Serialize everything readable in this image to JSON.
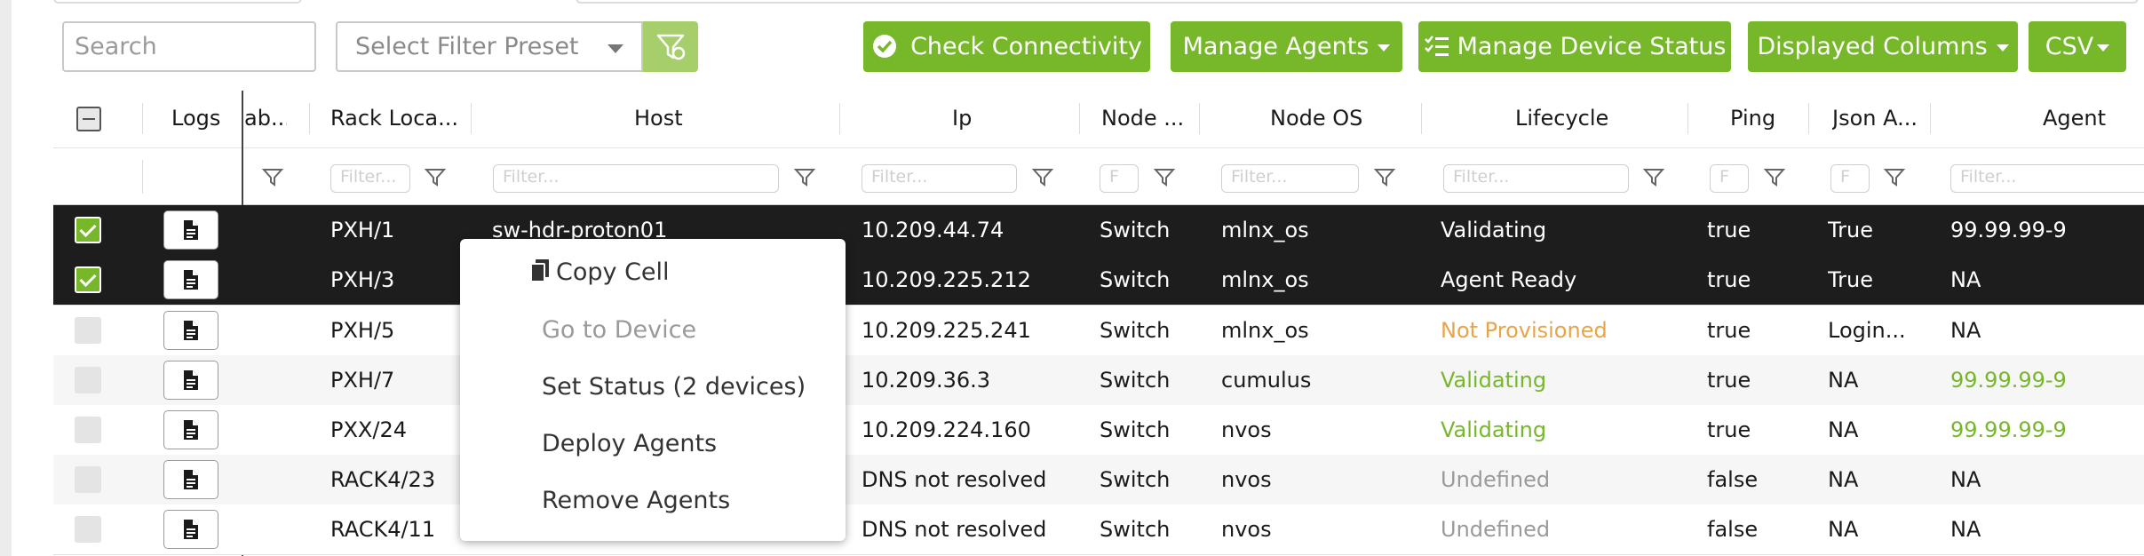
{
  "toolbar": {
    "search_placeholder": "Search",
    "filter_preset_placeholder": "Select Filter Preset",
    "check_connectivity": "Check Connectivity",
    "manage_agents": "Manage Agents",
    "manage_device_status": "Manage Device Status",
    "displayed_columns": "Displayed Columns",
    "csv": "CSV"
  },
  "columns": [
    "ab...",
    "Rack Loca...",
    "Host",
    "Ip",
    "Node ...",
    "Node OS",
    "Lifecycle",
    "Ping",
    "Json A...",
    "Agent"
  ],
  "logs_header": "Logs",
  "filter_placeholder": "Filter...",
  "filter_short": "F",
  "rows": [
    {
      "selected": true,
      "rack": "PXH/1",
      "host": "sw-hdr-proton01",
      "ip": "10.209.44.74",
      "type": "Switch",
      "os": "mlnx_os",
      "lifecycle": "Validating",
      "ping": "true",
      "json": "True",
      "agent": "99.99.99-9"
    },
    {
      "selected": true,
      "rack": "PXH/3",
      "host": "",
      "ip": "10.209.225.212",
      "type": "Switch",
      "os": "mlnx_os",
      "lifecycle": "Agent Ready",
      "ping": "true",
      "json": "True",
      "agent": "NA"
    },
    {
      "selected": false,
      "rack": "PXH/5",
      "host": "",
      "ip": "10.209.225.241",
      "type": "Switch",
      "os": "mlnx_os",
      "lifecycle": "Not Provisioned",
      "ping": "true",
      "json": "Login...",
      "agent": "NA"
    },
    {
      "selected": false,
      "rack": "PXH/7",
      "host": "",
      "ip": "10.209.36.3",
      "type": "Switch",
      "os": "cumulus",
      "lifecycle": "Validating",
      "ping": "true",
      "json": "NA",
      "agent": "99.99.99-9"
    },
    {
      "selected": false,
      "rack": "PXX/24",
      "host": "",
      "ip": "10.209.224.160",
      "type": "Switch",
      "os": "nvos",
      "lifecycle": "Validating",
      "ping": "true",
      "json": "NA",
      "agent": "99.99.99-9"
    },
    {
      "selected": false,
      "rack": "RACK4/23",
      "host": "",
      "ip": "DNS not resolved",
      "type": "Switch",
      "os": "nvos",
      "lifecycle": "Undefined",
      "ping": "false",
      "json": "NA",
      "agent": "NA"
    },
    {
      "selected": false,
      "rack": "RACK4/11",
      "host": "",
      "ip": "DNS not resolved",
      "type": "Switch",
      "os": "nvos",
      "lifecycle": "Undefined",
      "ping": "false",
      "json": "NA",
      "agent": "NA"
    }
  ],
  "context_menu": {
    "copy_cell": "Copy Cell",
    "go_to_device": "Go to Device",
    "set_status": "Set Status (2 devices)",
    "deploy_agents": "Deploy Agents",
    "remove_agents": "Remove Agents"
  },
  "colors": {
    "accent": "#76b82a",
    "selected_row": "#1d1d1d",
    "status_not_provisioned": "#e8a547",
    "status_validating": "#76b82a",
    "status_undefined": "#9a9a9a"
  }
}
